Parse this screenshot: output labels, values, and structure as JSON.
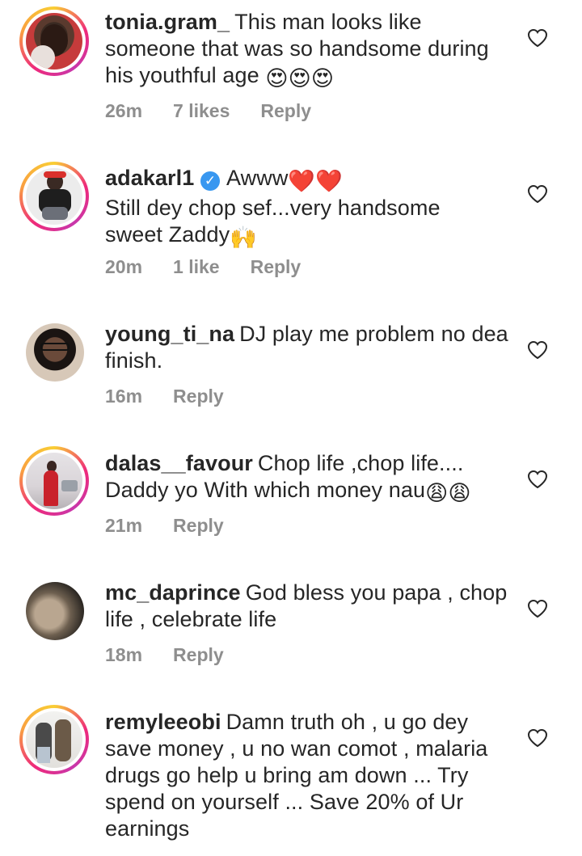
{
  "comments": [
    {
      "username": "tonia.gram_",
      "text_lines": [
        "This man looks like",
        "someone that was so handsome during",
        "his youthful age "
      ],
      "time": "26m",
      "likes": "7 likes",
      "reply": "Reply",
      "icon": "heart-eyes-emoji"
    },
    {
      "username": "adakarl1",
      "verified": true,
      "text_lines": [
        "Awww",
        "Still dey chop sef...very handsome",
        "sweet Zaddy"
      ],
      "time": "20m",
      "likes": "1 like",
      "reply": "Reply"
    },
    {
      "username": "young_ti_na",
      "text_lines": [
        "DJ play me problem no dea",
        "finish."
      ],
      "time": "16m",
      "reply": "Reply"
    },
    {
      "username": "dalas__favour",
      "text_lines": [
        "Chop life ,chop life....",
        "Daddy yo With which money nau"
      ],
      "time": "21m",
      "reply": "Reply"
    },
    {
      "username": "mc_daprince",
      "text_lines": [
        "God bless you papa , chop",
        "life , celebrate life"
      ],
      "time": "18m",
      "reply": "Reply"
    },
    {
      "username": "remyleeobi",
      "text_lines": [
        "Damn truth oh , u go dey",
        "save money , u no wan comot , malaria",
        "drugs  go help u bring am down ... Try",
        "spend on yourself ... Save 20% of Ur",
        "earnings"
      ]
    }
  ],
  "colors": {
    "text": "#262626",
    "meta": "#8e8e8e",
    "verified": "#3897f0"
  }
}
